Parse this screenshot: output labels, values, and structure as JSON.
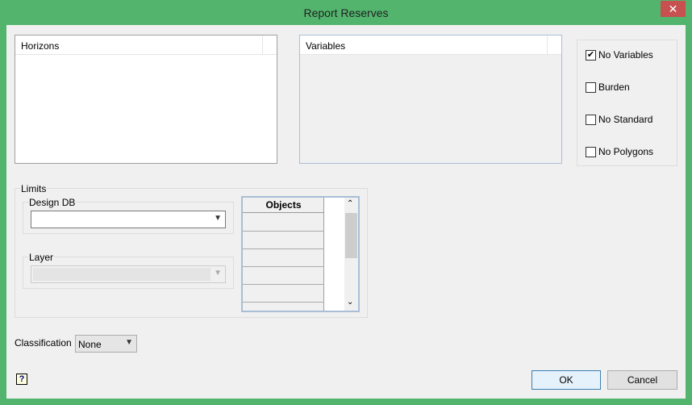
{
  "window": {
    "title": "Report Reserves",
    "close": "✕"
  },
  "horizons": {
    "header": "Horizons"
  },
  "variables": {
    "header": "Variables"
  },
  "options": [
    {
      "label": "No Variables",
      "checked": true
    },
    {
      "label": "Burden",
      "checked": false
    },
    {
      "label": "No Standard",
      "checked": false
    },
    {
      "label": "No Polygons",
      "checked": false
    }
  ],
  "limits": {
    "label": "Limits",
    "design_db_label": "Design DB",
    "design_db_value": "",
    "layer_label": "Layer",
    "layer_value": "",
    "objects_header": "Objects"
  },
  "classification": {
    "label": "Classification",
    "value": "None"
  },
  "buttons": {
    "ok": "OK",
    "cancel": "Cancel",
    "help": "?"
  }
}
